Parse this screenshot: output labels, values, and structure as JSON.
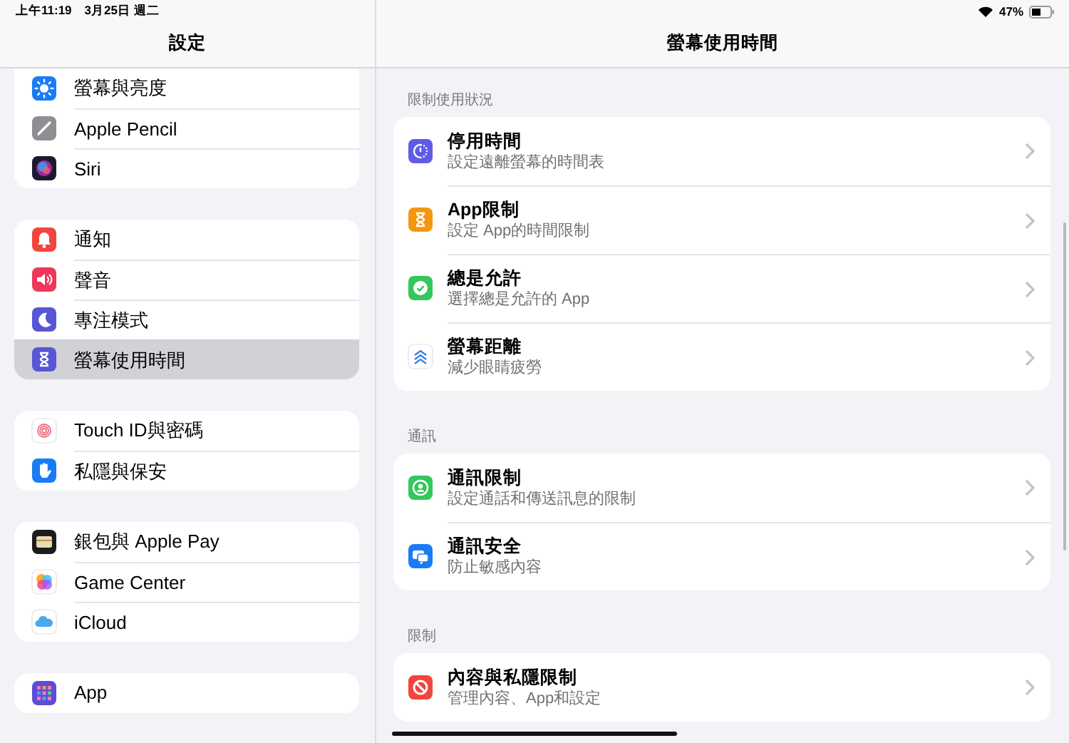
{
  "status_bar": {
    "time": "上午11:19",
    "date": "3月25日 週二",
    "battery": "47%"
  },
  "sidebar": {
    "title": "設定",
    "groups": [
      {
        "items": [
          {
            "kind": "brightness",
            "label": "螢幕與亮度",
            "selected": false
          },
          {
            "kind": "pencil",
            "label": "Apple Pencil",
            "selected": false
          },
          {
            "kind": "siri",
            "label": "Siri",
            "selected": false
          }
        ]
      },
      {
        "items": [
          {
            "kind": "notifications",
            "label": "通知",
            "selected": false
          },
          {
            "kind": "sounds",
            "label": "聲音",
            "selected": false
          },
          {
            "kind": "focus",
            "label": "專注模式",
            "selected": false
          },
          {
            "kind": "screen_time",
            "label": "螢幕使用時間",
            "selected": true
          }
        ]
      },
      {
        "items": [
          {
            "kind": "touch_id",
            "label": "Touch ID與密碼",
            "selected": false
          },
          {
            "kind": "privacy",
            "label": "私隱與保安",
            "selected": false
          }
        ]
      },
      {
        "items": [
          {
            "kind": "wallet",
            "label": "銀包與 Apple Pay",
            "selected": false
          },
          {
            "kind": "game_center",
            "label": "Game Center",
            "selected": false
          },
          {
            "kind": "icloud",
            "label": "iCloud",
            "selected": false
          }
        ]
      },
      {
        "items": [
          {
            "kind": "apps",
            "label": "App",
            "selected": false
          }
        ]
      }
    ]
  },
  "detail": {
    "title": "螢幕使用時間",
    "sections": [
      {
        "header": "限制使用狀況",
        "items": [
          {
            "kind": "downtime",
            "title": "停用時間",
            "subtitle": "設定遠離螢幕的時間表"
          },
          {
            "kind": "app_limits",
            "title": "App限制",
            "subtitle": "設定 App的時間限制"
          },
          {
            "kind": "always_allowed",
            "title": "總是允許",
            "subtitle": "選擇總是允許的 App"
          },
          {
            "kind": "screen_distance",
            "title": "螢幕距離",
            "subtitle": "減少眼睛疲勞"
          }
        ]
      },
      {
        "header": "通訊",
        "items": [
          {
            "kind": "comm_limits",
            "title": "通訊限制",
            "subtitle": "設定通話和傳送訊息的限制"
          },
          {
            "kind": "comm_safety",
            "title": "通訊安全",
            "subtitle": "防止敏感內容"
          }
        ]
      },
      {
        "header": "限制",
        "items": [
          {
            "kind": "content_restrictions",
            "title": "內容與私隱限制",
            "subtitle": "管理內容、App和設定"
          }
        ]
      }
    ]
  }
}
